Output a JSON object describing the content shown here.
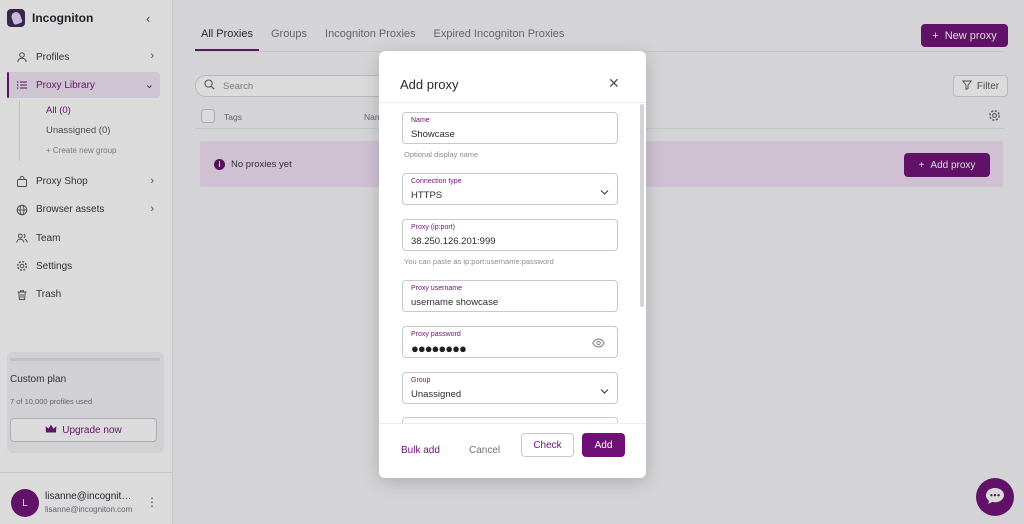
{
  "app": {
    "name": "Incogniton"
  },
  "sidebar": {
    "items": [
      {
        "label": "Profiles",
        "icon": "user-icon"
      },
      {
        "label": "Proxy Library",
        "icon": "list-icon"
      },
      {
        "label": "Proxy Shop",
        "icon": "bag-icon"
      },
      {
        "label": "Browser assets",
        "icon": "globe-icon"
      },
      {
        "label": "Team",
        "icon": "team-icon"
      },
      {
        "label": "Settings",
        "icon": "gear-icon"
      },
      {
        "label": "Trash",
        "icon": "trash-icon"
      }
    ],
    "proxy_groups": [
      {
        "label": "All (0)"
      },
      {
        "label": "Unassigned (0)"
      },
      {
        "label": "+ Create new group"
      }
    ],
    "plan": {
      "title": "Custom plan",
      "usage": "7 of 10,000 profiles used",
      "usage_fraction": 0.0007,
      "upgrade_label": "Upgrade now"
    },
    "user": {
      "initial": "L",
      "name": "lisanne@incogniton.com",
      "email": "lisanne@incogniton.com"
    }
  },
  "main": {
    "tabs": [
      {
        "label": "All Proxies"
      },
      {
        "label": "Groups"
      },
      {
        "label": "Incogniton Proxies"
      },
      {
        "label": "Expired Incogniton Proxies"
      }
    ],
    "new_proxy_label": "New proxy",
    "search_placeholder": "Search",
    "filter_label": "Filter",
    "table": {
      "col_tags": "Tags",
      "col_name": "Name"
    },
    "empty_text": "No proxies yet",
    "add_proxy_label": "Add proxy"
  },
  "modal": {
    "title": "Add proxy",
    "fields": {
      "name": {
        "label": "Name",
        "value": "Showcase",
        "helper": "Optional display name"
      },
      "connection": {
        "label": "Connection type",
        "value": "HTTPS"
      },
      "proxy": {
        "label": "Proxy (ip:port)",
        "value": "38.250.126.201:999",
        "helper": "You can paste as ip:port:username:password"
      },
      "username": {
        "label": "Proxy username",
        "value": "username showcase"
      },
      "password": {
        "label": "Proxy password",
        "masked": "●●●●●●●●"
      },
      "group": {
        "label": "Group",
        "value": "Unassigned"
      }
    },
    "footer": {
      "bulk_label": "Bulk add",
      "cancel_label": "Cancel",
      "check_label": "Check",
      "add_label": "Add"
    }
  },
  "colors": {
    "accent": "#6e1075",
    "accent_light": "#f1e0f3"
  }
}
